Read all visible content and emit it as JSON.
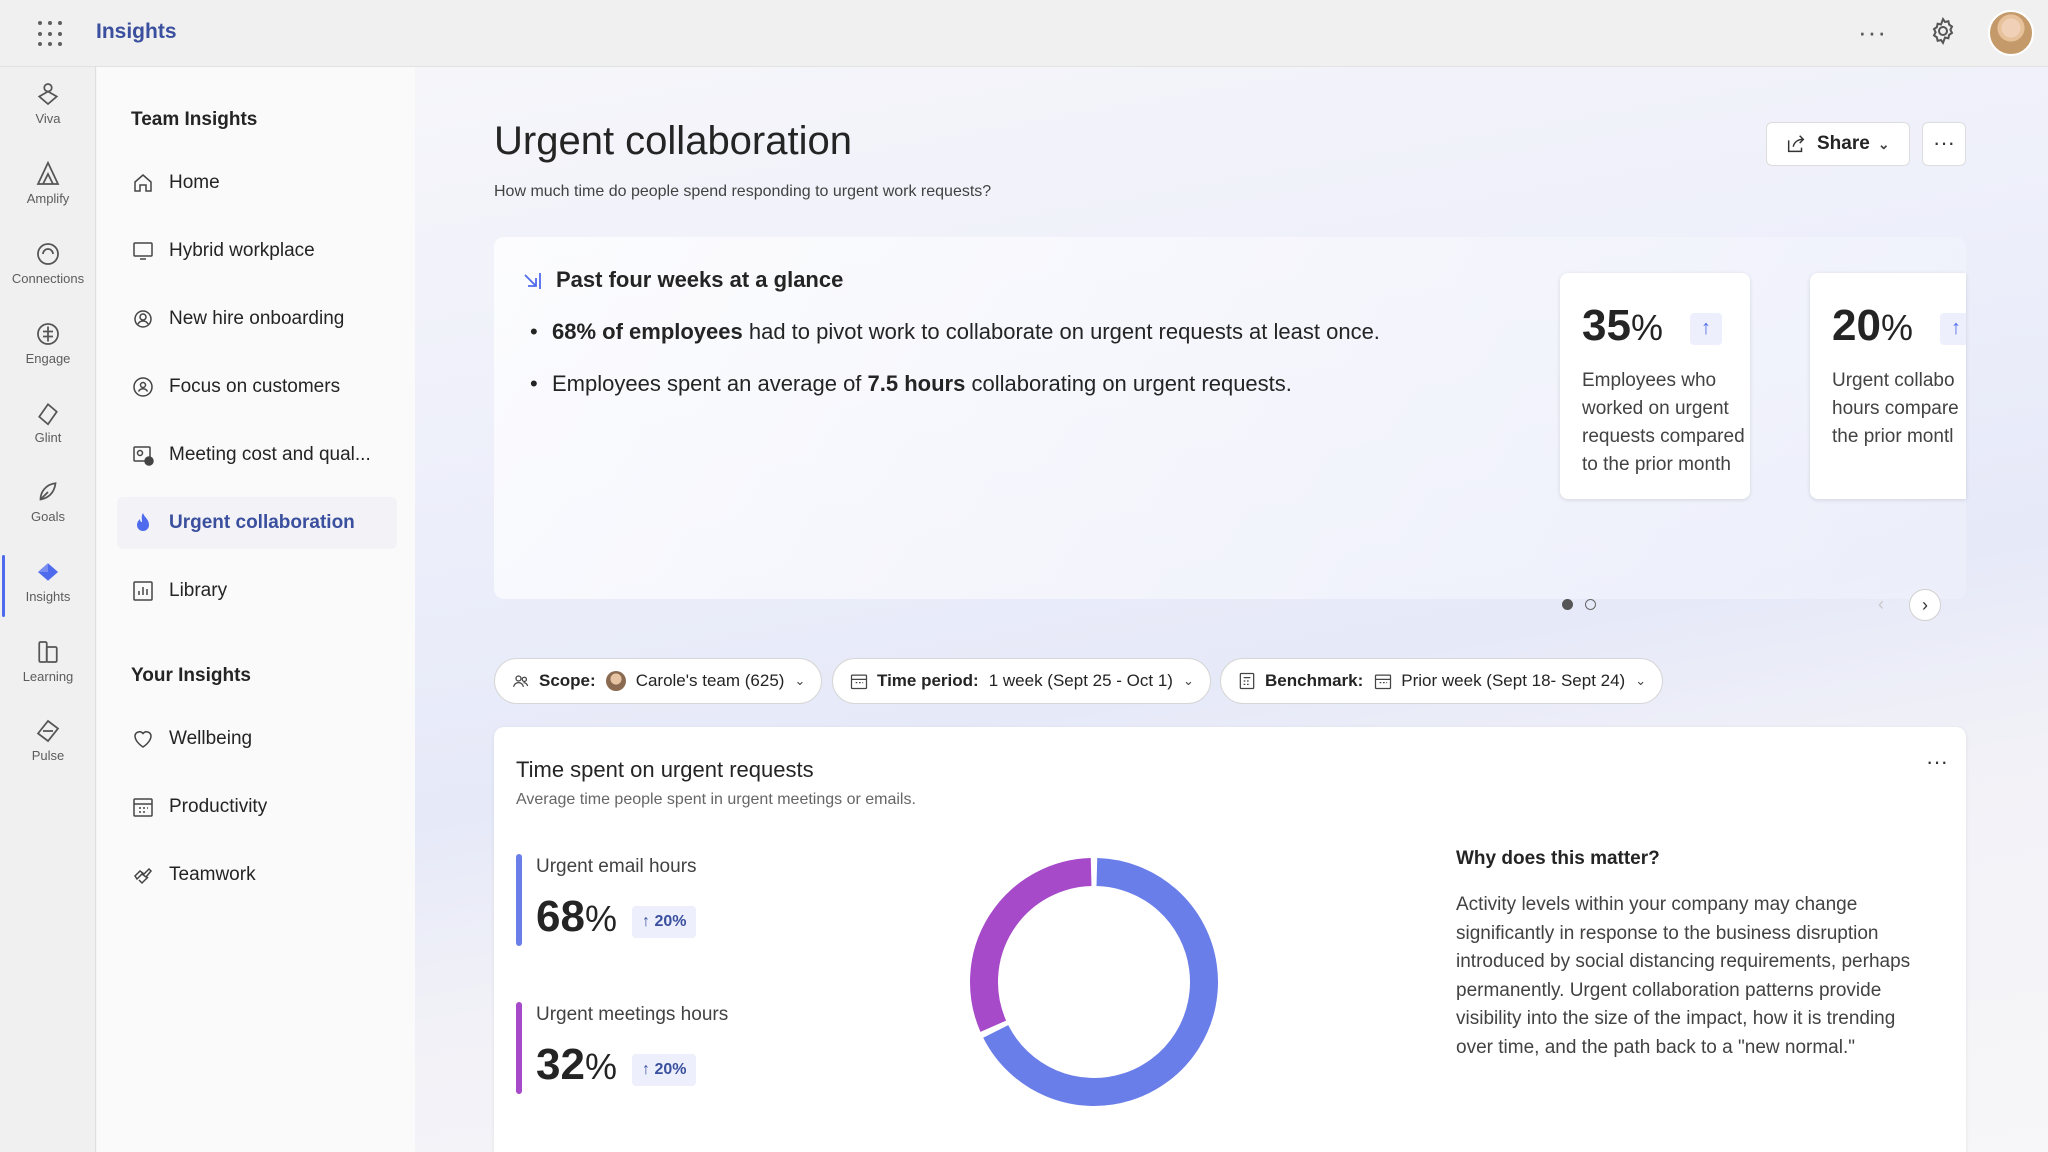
{
  "app": {
    "title": "Insights"
  },
  "rail": [
    {
      "label": "Viva",
      "icon": "viva-icon"
    },
    {
      "label": "Amplify",
      "icon": "amplify-icon"
    },
    {
      "label": "Connections",
      "icon": "connections-icon"
    },
    {
      "label": "Engage",
      "icon": "engage-icon"
    },
    {
      "label": "Glint",
      "icon": "glint-icon"
    },
    {
      "label": "Goals",
      "icon": "goals-icon"
    },
    {
      "label": "Insights",
      "icon": "insights-icon"
    },
    {
      "label": "Learning",
      "icon": "learning-icon"
    },
    {
      "label": "Pulse",
      "icon": "pulse-icon"
    }
  ],
  "nav": {
    "team_heading": "Team Insights",
    "team_items": [
      {
        "label": "Home",
        "icon": "home-icon"
      },
      {
        "label": "Hybrid workplace",
        "icon": "monitor-icon"
      },
      {
        "label": "New hire onboarding",
        "icon": "person-add-icon"
      },
      {
        "label": "Focus on customers",
        "icon": "people-focus-icon"
      },
      {
        "label": "Meeting cost and qual...",
        "icon": "meeting-cost-icon"
      },
      {
        "label": "Urgent collaboration",
        "icon": "flame-icon"
      },
      {
        "label": "Library",
        "icon": "chart-library-icon"
      }
    ],
    "your_heading": "Your Insights",
    "your_items": [
      {
        "label": "Wellbeing",
        "icon": "heart-icon"
      },
      {
        "label": "Productivity",
        "icon": "calendar-grid-icon"
      },
      {
        "label": "Teamwork",
        "icon": "teamwork-icon"
      }
    ]
  },
  "page": {
    "title": "Urgent collaboration",
    "subtitle": "How much time do people spend responding to urgent work requests?",
    "share_label": "Share",
    "more_label": "···"
  },
  "glance": {
    "title": "Past four weeks at a glance",
    "bullet1_bold": "68% of employees",
    "bullet1_rest": " had to pivot work to collaborate on urgent requests at least once.",
    "bullet2_pre": "Employees spent an average of ",
    "bullet2_bold": "7.5 hours",
    "bullet2_rest": " collaborating on urgent requests.",
    "cards": [
      {
        "value": "35",
        "unit": "%",
        "trend": "up",
        "desc_lines": [
          "Employees who",
          "worked on urgent",
          "requests compared",
          "to the prior month"
        ]
      },
      {
        "value": "20",
        "unit": "%",
        "trend": "up",
        "desc_lines": [
          "Urgent collabo",
          "hours compare",
          "the prior montl"
        ]
      }
    ],
    "carousel_page": 1,
    "carousel_total": 2
  },
  "filters": {
    "scope_label": "Scope:",
    "scope_value": "Carole's team (625)",
    "time_label": "Time period:",
    "time_value": "1 week (Sept 25 - Oct 1)",
    "bench_label": "Benchmark:",
    "bench_value": "Prior week (Sept 18- Sept 24)"
  },
  "chart_card": {
    "title": "Time spent on urgent requests",
    "subtitle": "Average time people spent in urgent meetings or emails.",
    "metrics": [
      {
        "label": "Urgent email hours",
        "value": "68",
        "unit": "%",
        "change": "20%",
        "color": "#6a7eea"
      },
      {
        "label": "Urgent meetings hours",
        "value": "32",
        "unit": "%",
        "change": "20%",
        "color": "#a64ac9"
      }
    ],
    "why_title": "Why does this matter?",
    "why_body": "Activity levels within your company may change significantly in response to the business disruption introduced by social distancing requirements, perhaps permanently. Urgent collaboration patterns provide visibility into the size of the impact, how it is trending over time, and the path back to a \"new normal.\""
  },
  "chart_data": {
    "type": "pie",
    "categories": [
      "Urgent email hours",
      "Urgent meetings hours"
    ],
    "values": [
      68,
      32
    ],
    "colors": [
      "#6a7eea",
      "#a64ac9"
    ],
    "donut": true
  }
}
